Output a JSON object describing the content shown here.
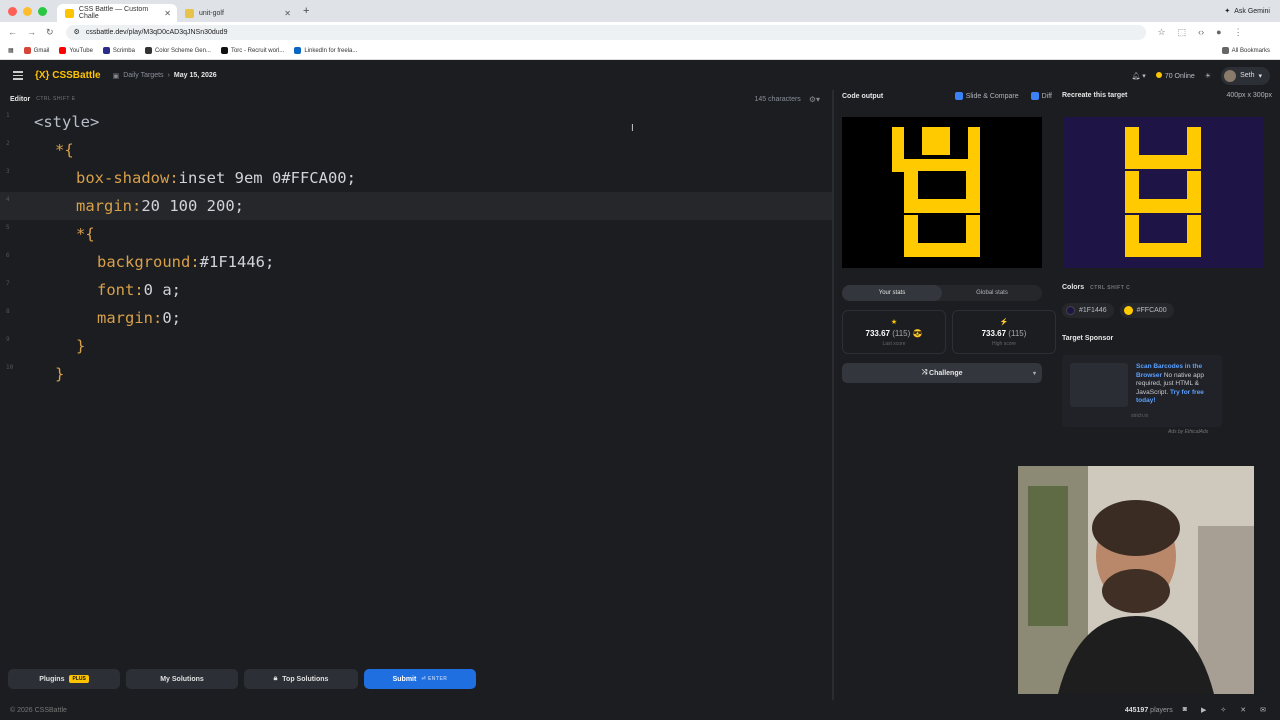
{
  "browser": {
    "tabs": [
      {
        "title": "CSS Battle — Custom Challe",
        "active": true
      },
      {
        "title": "unit-golf",
        "active": false
      }
    ],
    "ask_gemini": "Ask Gemini",
    "url": "cssbattle.dev/play/M3qD0cAD3qJNSn30dud9",
    "bookmarks": [
      "Gmail",
      "YouTube",
      "Scrimba",
      "Color Scheme Gen...",
      "Torc - Recruit worl...",
      "LinkedIn for freela..."
    ],
    "all_bookmarks": "All Bookmarks"
  },
  "app": {
    "logo": "{X} CSSBattle",
    "crumb_daily": "Daily Targets",
    "crumb_date": "May 15, 2026",
    "online": "70 Online",
    "user": "Seth"
  },
  "editor": {
    "label": "Editor",
    "shortcut": "CTRL  SHIFT  E",
    "chars": "145 characters",
    "lines": [
      {
        "num": "1",
        "parts": [
          [
            "c-tag",
            "<style>"
          ]
        ],
        "indent": 34
      },
      {
        "num": "2",
        "parts": [
          [
            "c-sel",
            "*{"
          ]
        ],
        "indent": 55
      },
      {
        "num": "3",
        "parts": [
          [
            "c-prop",
            "box-shadow:"
          ],
          [
            "c-val",
            "inset 9em 0#FFCA00;"
          ]
        ],
        "indent": 76
      },
      {
        "num": "4",
        "parts": [
          [
            "c-prop",
            "margin:"
          ],
          [
            "c-val",
            "20 100 200;"
          ]
        ],
        "indent": 76,
        "highlight": true
      },
      {
        "num": "5",
        "parts": [
          [
            "c-sel",
            "*{"
          ]
        ],
        "indent": 76
      },
      {
        "num": "6",
        "parts": [
          [
            "c-prop",
            "background:"
          ],
          [
            "c-val",
            "#1F1446;"
          ]
        ],
        "indent": 97
      },
      {
        "num": "7",
        "parts": [
          [
            "c-prop",
            "font:"
          ],
          [
            "c-val",
            "0 a;"
          ]
        ],
        "indent": 97
      },
      {
        "num": "8",
        "parts": [
          [
            "c-prop",
            "margin:"
          ],
          [
            "c-val",
            "0;"
          ]
        ],
        "indent": 97
      },
      {
        "num": "9",
        "parts": [
          [
            "c-sel",
            "}"
          ]
        ],
        "indent": 76
      },
      {
        "num": "10",
        "parts": [
          [
            "c-sel",
            "}"
          ]
        ],
        "indent": 55
      }
    ]
  },
  "footer": {
    "plugins": "Plugins",
    "plus": "PLUS",
    "my_solutions": "My Solutions",
    "top_solutions": "Top Solutions",
    "submit": "Submit",
    "enter": "ENTER",
    "copyright": "© 2026 CSSBattle",
    "players_count": "445197",
    "players_label": "players"
  },
  "output": {
    "title": "Code output",
    "slide_compare": "Slide & Compare",
    "diff": "Diff",
    "stats_tab_yours": "Your stats",
    "stats_tab_global": "Global stats",
    "last_score": "733.67",
    "last_count": "(115)",
    "last_label": "Last score",
    "high_score": "733.67",
    "high_count": "(115)",
    "high_label": "High score",
    "challenge": "Challenge"
  },
  "target": {
    "title": "Recreate this target",
    "size": "400px x 300px",
    "colors_label": "Colors",
    "colors_shortcut": "CTRL  SHIFT  C",
    "colors": [
      {
        "hex": "#1F1446"
      },
      {
        "hex": "#FFCA00"
      }
    ],
    "sponsor_label": "Target Sponsor",
    "ad_title": "Scan Barcodes in the Browser",
    "ad_body": "No native app required, just HTML & JavaScript.",
    "ad_cta": "Try for free today!",
    "ad_domain": "strich.io",
    "ad_by": "Ads by EthicalAds"
  },
  "palette": {
    "yellow": "#FFCA00",
    "navy": "#1F1446",
    "accent": "#1F6FE0"
  }
}
